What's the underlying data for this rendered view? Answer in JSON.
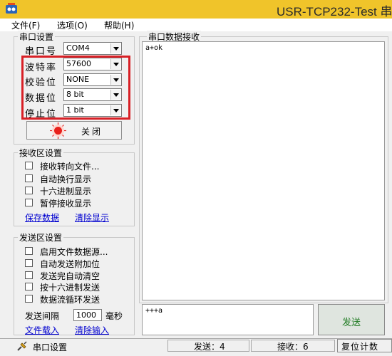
{
  "window": {
    "title": "USR-TCP232-Test 串"
  },
  "menu": {
    "items": [
      "文件(F)",
      "选项(O)",
      "帮助(H)"
    ]
  },
  "serial_settings": {
    "group_label": "串口设置",
    "port": {
      "label": "串口号",
      "value": "COM4"
    },
    "baud": {
      "label": "波特率",
      "value": "57600"
    },
    "parity": {
      "label": "校验位",
      "value": "NONE"
    },
    "databits": {
      "label": "数据位",
      "value": "8 bit"
    },
    "stopbits": {
      "label": "停止位",
      "value": "1 bit"
    },
    "close_button": "关闭"
  },
  "receive_settings": {
    "group_label": "接收区设置",
    "options": [
      "接收转向文件...",
      "自动换行显示",
      "十六进制显示",
      "暂停接收显示"
    ],
    "save_link": "保存数据",
    "clear_link": "清除显示"
  },
  "send_settings": {
    "group_label": "发送区设置",
    "options": [
      "启用文件数据源...",
      "自动发送附加位",
      "发送完自动清空",
      "按十六进制发送",
      "数据流循环发送"
    ],
    "interval_label": "发送间隔",
    "interval_value": "1000",
    "interval_unit": "毫秒",
    "load_link": "文件载入",
    "clear_link": "清除输入"
  },
  "receive_area": {
    "group_label": "串口数据接收",
    "content": "a+ok"
  },
  "send_area": {
    "content": "+++a",
    "send_button": "发送"
  },
  "status": {
    "mode": "串口设置",
    "sent": "发送：4",
    "received": "接收：6",
    "reset_button": "复位计数"
  },
  "colors": {
    "title_bar": "#f0c42a",
    "highlight_box": "#d82026",
    "link": "#0000d0"
  }
}
